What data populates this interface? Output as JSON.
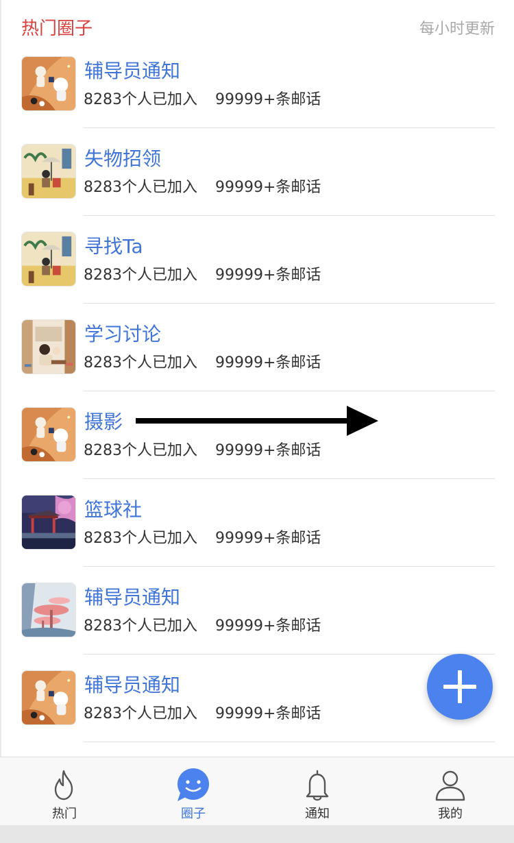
{
  "header": {
    "title": "热门圈子",
    "update_note": "每小时更新"
  },
  "circles": [
    {
      "name": "辅导员通知",
      "members": "8283个人已加入",
      "posts": "99999+条邮话",
      "thumb": "astronaut-orange"
    },
    {
      "name": "失物招领",
      "members": "8283个人已加入",
      "posts": "99999+条邮话",
      "thumb": "garden-umbrella"
    },
    {
      "name": "寻找Ta",
      "members": "8283个人已加入",
      "posts": "99999+条邮话",
      "thumb": "garden-umbrella"
    },
    {
      "name": "学习讨论",
      "members": "8283个人已加入",
      "posts": "99999+条邮话",
      "thumb": "study-room"
    },
    {
      "name": "摄影",
      "members": "8283个人已加入",
      "posts": "99999+条邮话",
      "thumb": "astronaut-orange"
    },
    {
      "name": "篮球社",
      "members": "8283个人已加入",
      "posts": "99999+条邮话",
      "thumb": "pavilion-night"
    },
    {
      "name": "辅导员通知",
      "members": "8283个人已加入",
      "posts": "99999+条邮话",
      "thumb": "pink-forest"
    },
    {
      "name": "辅导员通知",
      "members": "8283个人已加入",
      "posts": "99999+条邮话",
      "thumb": "astronaut-orange"
    }
  ],
  "fab": {
    "icon": "plus-icon",
    "color": "#4b82ee"
  },
  "tabbar": {
    "tabs": [
      {
        "label": "热门",
        "icon": "flame-icon",
        "active": false
      },
      {
        "label": "圈子",
        "icon": "smile-chat-icon",
        "active": true
      },
      {
        "label": "通知",
        "icon": "bell-icon",
        "active": false
      },
      {
        "label": "我的",
        "icon": "user-icon",
        "active": false
      }
    ]
  },
  "colors": {
    "title_red": "#d9413f",
    "link_blue": "#3f74d8",
    "accent_blue": "#4b82ee"
  }
}
